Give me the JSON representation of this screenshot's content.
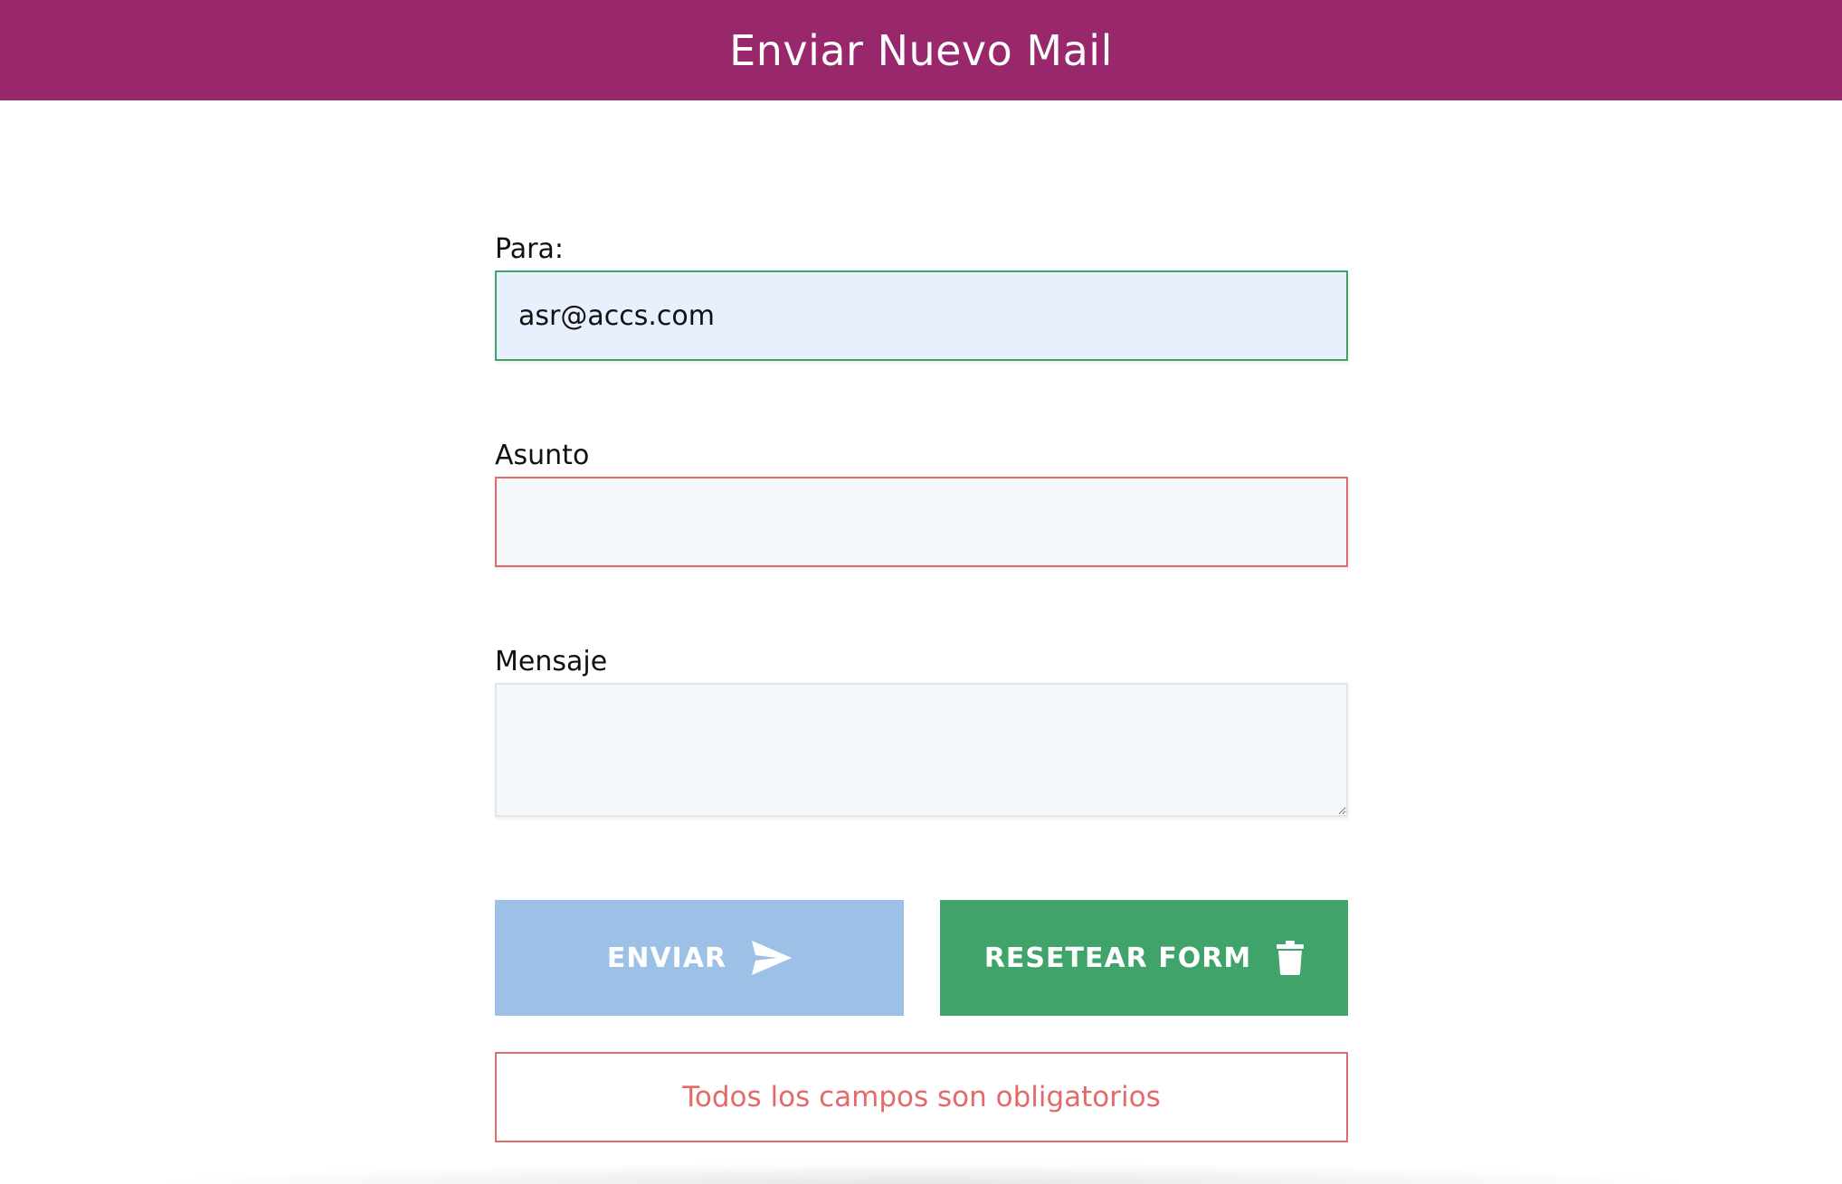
{
  "header": {
    "title": "Enviar Nuevo Mail",
    "background_color": "#98276b"
  },
  "form": {
    "to": {
      "label": "Para:",
      "value": "asr@accs.com",
      "status": "valid",
      "border_color": "#3fa36a"
    },
    "subject": {
      "label": "Asunto",
      "value": "",
      "status": "invalid",
      "border_color": "#e46a6a"
    },
    "message": {
      "label": "Mensaje",
      "value": ""
    }
  },
  "buttons": {
    "send": {
      "label": "ENVIAR",
      "icon": "paper-plane-icon",
      "color": "#9dc1e6",
      "disabled": true
    },
    "reset": {
      "label": "RESETEAR FORM",
      "icon": "trash-icon",
      "color": "#3fa36a"
    }
  },
  "error": {
    "message": "Todos los campos son obligatorios",
    "color": "#e46a6a"
  }
}
